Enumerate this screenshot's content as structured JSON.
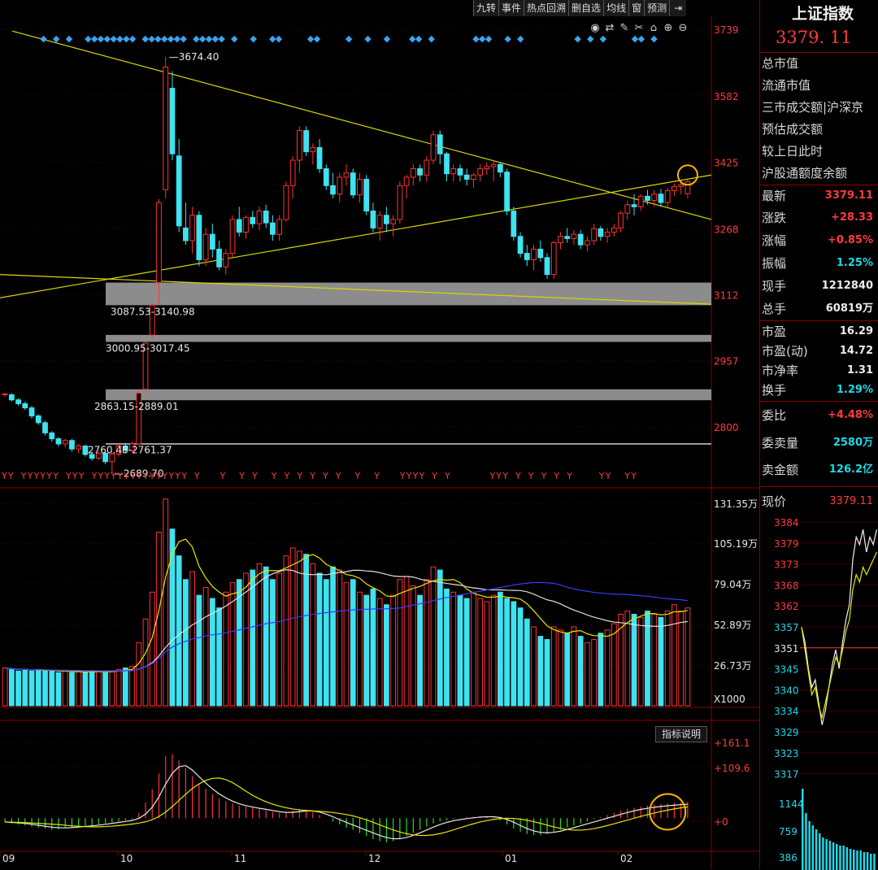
{
  "toolbar": {
    "buttons": [
      "九转",
      "事件",
      "热点回溯",
      "删自选",
      "均线",
      "窗",
      "预测"
    ],
    "icons": [
      "eye-icon",
      "toggle-icon",
      "brush-icon",
      "scissors-icon",
      "lock-icon",
      "zoom-in-icon",
      "zoom-out-icon"
    ]
  },
  "sidebar": {
    "name": "上证指数",
    "price": "3379. 11",
    "info_labels": [
      "总市值",
      "流通市值",
      "三市成交额|沪深京",
      "预估成交额",
      "较上日此时",
      "沪股通额度余额"
    ],
    "stats": [
      {
        "label": "最新",
        "value": "3379.11",
        "color": "red"
      },
      {
        "label": "涨跌",
        "value": "+28.33",
        "color": "red"
      },
      {
        "label": "涨幅",
        "value": "+0.85%",
        "color": "red"
      },
      {
        "label": "振幅",
        "value": "1.25%",
        "color": "cyan"
      },
      {
        "label": "现手",
        "value": "1212840",
        "color": "white"
      },
      {
        "label": "总手",
        "value": "60819万",
        "color": "white"
      }
    ],
    "valuation": [
      {
        "label": "市盈",
        "value": "16.29",
        "color": "white"
      },
      {
        "label": "市盈(动)",
        "value": "14.72",
        "color": "white"
      },
      {
        "label": "市净率",
        "value": "1.31",
        "color": "white"
      },
      {
        "label": "换手",
        "value": "1.29%",
        "color": "cyan"
      }
    ],
    "orders": [
      {
        "label": "委比",
        "value": "+4.48%",
        "color": "red"
      },
      {
        "label": "委卖量",
        "value": "2580万",
        "color": "cyan"
      },
      {
        "label": "卖金额",
        "value": "126.2亿",
        "color": "cyan"
      }
    ],
    "current_label": "现价",
    "current_value": "3379.11",
    "mini_price_ticks": [
      "3384",
      "3379",
      "3373",
      "3368",
      "3362",
      "3357",
      "3351",
      "3345",
      "3340",
      "3334",
      "3329",
      "3323",
      "3317"
    ],
    "mini_vol_ticks": [
      "1144",
      "759",
      "386"
    ]
  },
  "indicator_note": "指标说明",
  "chart_data": {
    "type": "candlestick",
    "title": "",
    "price_axis": {
      "ticks": [
        3739,
        3582,
        3425,
        3268,
        3112,
        2957,
        2800
      ],
      "range": [
        2660,
        3770
      ]
    },
    "volume_axis": {
      "ticks": [
        "131.35万",
        "105.19万",
        "79.04万",
        "52.89万",
        "26.73万"
      ],
      "unit": "X1000",
      "range": [
        0,
        135
      ]
    },
    "macd_axis": {
      "ticks": [
        "+161.1",
        "+109.6",
        "+0"
      ],
      "range": [
        -60,
        180
      ]
    },
    "x_month_labels": [
      "09",
      "10",
      "11",
      "12",
      "01",
      "02"
    ],
    "annotations": [
      "3674.40",
      "3087.53-3140.98",
      "3000.95-3017.45",
      "2863.15-2889.01",
      "2760.48-2761.37",
      "2689.70"
    ],
    "gaps": [
      {
        "low": 3087.53,
        "high": 3140.98
      },
      {
        "low": 3000.95,
        "high": 3017.45
      },
      {
        "low": 2863.15,
        "high": 2889.01
      },
      {
        "low": 2760.48,
        "high": 2761.37
      }
    ],
    "signal_rows": {
      "top_marker": "◆",
      "bottom_marker": "Y"
    },
    "candles": [
      [
        2876,
        2880,
        2872,
        2878
      ],
      [
        2876,
        2880,
        2860,
        2864
      ],
      [
        2864,
        2868,
        2850,
        2855
      ],
      [
        2855,
        2860,
        2840,
        2845
      ],
      [
        2845,
        2850,
        2820,
        2826
      ],
      [
        2826,
        2830,
        2805,
        2810
      ],
      [
        2810,
        2815,
        2780,
        2786
      ],
      [
        2786,
        2790,
        2765,
        2772
      ],
      [
        2772,
        2776,
        2754,
        2760
      ],
      [
        2760,
        2772,
        2752,
        2768
      ],
      [
        2768,
        2772,
        2742,
        2748
      ],
      [
        2748,
        2760,
        2738,
        2755
      ],
      [
        2755,
        2758,
        2730,
        2735
      ],
      [
        2735,
        2742,
        2720,
        2726
      ],
      [
        2726,
        2742,
        2722,
        2738
      ],
      [
        2738,
        2742,
        2712,
        2718
      ],
      [
        2718,
        2740,
        2689.7,
        2736
      ],
      [
        2736,
        2760,
        2730,
        2755
      ],
      [
        2755,
        2762,
        2740,
        2745
      ],
      [
        2745,
        2765,
        2740,
        2760
      ],
      [
        2760,
        2885,
        2758,
        2880
      ],
      [
        2889,
        3002,
        2885,
        2998
      ],
      [
        3017,
        3092,
        3010,
        3088
      ],
      [
        3141,
        3338,
        3090,
        3330
      ],
      [
        3360,
        3674.4,
        3340,
        3650
      ],
      [
        3600,
        3640,
        3430,
        3445
      ],
      [
        3440,
        3480,
        3260,
        3275
      ],
      [
        3270,
        3330,
        3230,
        3240
      ],
      [
        3240,
        3320,
        3210,
        3300
      ],
      [
        3300,
        3310,
        3180,
        3195
      ],
      [
        3195,
        3270,
        3180,
        3255
      ],
      [
        3255,
        3280,
        3200,
        3220
      ],
      [
        3220,
        3240,
        3170,
        3178
      ],
      [
        3178,
        3220,
        3160,
        3210
      ],
      [
        3210,
        3300,
        3200,
        3290
      ],
      [
        3290,
        3320,
        3250,
        3260
      ],
      [
        3260,
        3300,
        3245,
        3295
      ],
      [
        3295,
        3310,
        3270,
        3280
      ],
      [
        3280,
        3320,
        3265,
        3310
      ],
      [
        3310,
        3325,
        3270,
        3282
      ],
      [
        3282,
        3300,
        3240,
        3255
      ],
      [
        3255,
        3300,
        3240,
        3290
      ],
      [
        3290,
        3380,
        3285,
        3370
      ],
      [
        3370,
        3440,
        3340,
        3430
      ],
      [
        3430,
        3510,
        3400,
        3500
      ],
      [
        3500,
        3510,
        3440,
        3450
      ],
      [
        3450,
        3470,
        3420,
        3460
      ],
      [
        3460,
        3480,
        3400,
        3410
      ],
      [
        3410,
        3420,
        3360,
        3370
      ],
      [
        3370,
        3400,
        3340,
        3350
      ],
      [
        3350,
        3400,
        3330,
        3390
      ],
      [
        3390,
        3420,
        3370,
        3400
      ],
      [
        3400,
        3410,
        3340,
        3348
      ],
      [
        3348,
        3400,
        3330,
        3385
      ],
      [
        3385,
        3395,
        3300,
        3310
      ],
      [
        3310,
        3330,
        3260,
        3270
      ],
      [
        3270,
        3310,
        3240,
        3300
      ],
      [
        3300,
        3320,
        3260,
        3280
      ],
      [
        3280,
        3300,
        3250,
        3290
      ],
      [
        3290,
        3380,
        3280,
        3370
      ],
      [
        3370,
        3395,
        3340,
        3390
      ],
      [
        3390,
        3420,
        3370,
        3410
      ],
      [
        3410,
        3420,
        3380,
        3395
      ],
      [
        3395,
        3440,
        3380,
        3430
      ],
      [
        3430,
        3500,
        3420,
        3490
      ],
      [
        3490,
        3500,
        3420,
        3445
      ],
      [
        3445,
        3450,
        3380,
        3398
      ],
      [
        3398,
        3420,
        3380,
        3410
      ],
      [
        3410,
        3420,
        3380,
        3395
      ],
      [
        3395,
        3410,
        3370,
        3385
      ],
      [
        3385,
        3400,
        3365,
        3395
      ],
      [
        3395,
        3420,
        3380,
        3410
      ],
      [
        3410,
        3425,
        3395,
        3415
      ],
      [
        3415,
        3430,
        3380,
        3420
      ],
      [
        3420,
        3425,
        3390,
        3402
      ],
      [
        3402,
        3410,
        3300,
        3310
      ],
      [
        3310,
        3320,
        3240,
        3250
      ],
      [
        3250,
        3260,
        3200,
        3210
      ],
      [
        3210,
        3230,
        3180,
        3195
      ],
      [
        3195,
        3230,
        3170,
        3220
      ],
      [
        3220,
        3240,
        3190,
        3200
      ],
      [
        3200,
        3210,
        3150,
        3160
      ],
      [
        3160,
        3240,
        3150,
        3235
      ],
      [
        3235,
        3260,
        3220,
        3250
      ],
      [
        3250,
        3270,
        3235,
        3245
      ],
      [
        3245,
        3265,
        3230,
        3255
      ],
      [
        3255,
        3265,
        3220,
        3230
      ],
      [
        3230,
        3250,
        3215,
        3240
      ],
      [
        3240,
        3280,
        3230,
        3268
      ],
      [
        3268,
        3275,
        3240,
        3250
      ],
      [
        3250,
        3270,
        3235,
        3260
      ],
      [
        3260,
        3280,
        3250,
        3270
      ],
      [
        3270,
        3310,
        3260,
        3305
      ],
      [
        3305,
        3335,
        3290,
        3325
      ],
      [
        3325,
        3350,
        3300,
        3320
      ],
      [
        3320,
        3350,
        3310,
        3345
      ],
      [
        3345,
        3360,
        3325,
        3335
      ],
      [
        3335,
        3360,
        3320,
        3350
      ],
      [
        3350,
        3362,
        3320,
        3330
      ],
      [
        3330,
        3365,
        3318,
        3358
      ],
      [
        3358,
        3375,
        3345,
        3368
      ],
      [
        3368,
        3380,
        3350,
        3372
      ],
      [
        3351,
        3384,
        3340,
        3379.11
      ]
    ],
    "volume": [
      24,
      23,
      22,
      23,
      22,
      23,
      22,
      22,
      21,
      22,
      21,
      22,
      21,
      22,
      22,
      21,
      22,
      23,
      24,
      25,
      40,
      55,
      72,
      110,
      131,
      112,
      95,
      80,
      85,
      70,
      75,
      68,
      62,
      72,
      78,
      80,
      84,
      86,
      90,
      88,
      80,
      84,
      95,
      100,
      98,
      96,
      90,
      84,
      80,
      88,
      86,
      78,
      80,
      72,
      70,
      74,
      68,
      64,
      70,
      80,
      82,
      76,
      70,
      80,
      88,
      86,
      74,
      72,
      70,
      68,
      72,
      68,
      66,
      70,
      72,
      68,
      66,
      62,
      55,
      50,
      44,
      42,
      50,
      48,
      46,
      50,
      44,
      40,
      42,
      46,
      48,
      52,
      58,
      60,
      58,
      56,
      60,
      58,
      56,
      60,
      64,
      60,
      62
    ],
    "macd_hist": [
      -8,
      -10,
      -12,
      -14,
      -16,
      -18,
      -20,
      -22,
      -21,
      -19,
      -18,
      -17,
      -16,
      -14,
      -12,
      -10,
      -8,
      -6,
      -4,
      -2,
      10,
      30,
      55,
      85,
      118,
      122,
      110,
      95,
      80,
      66,
      56,
      46,
      38,
      32,
      28,
      24,
      22,
      20,
      18,
      15,
      12,
      10,
      12,
      15,
      18,
      16,
      12,
      6,
      0,
      -6,
      -12,
      -18,
      -22,
      -28,
      -34,
      -40,
      -44,
      -46,
      -44,
      -40,
      -34,
      -28,
      -22,
      -16,
      -10,
      -6,
      -4,
      -2,
      0,
      2,
      3,
      4,
      3,
      2,
      -4,
      -12,
      -20,
      -26,
      -30,
      -32,
      -32,
      -30,
      -26,
      -22,
      -18,
      -14,
      -10,
      -6,
      -2,
      2,
      6,
      10,
      14,
      18,
      20,
      22,
      24,
      26,
      27,
      28,
      29,
      30,
      31
    ]
  }
}
